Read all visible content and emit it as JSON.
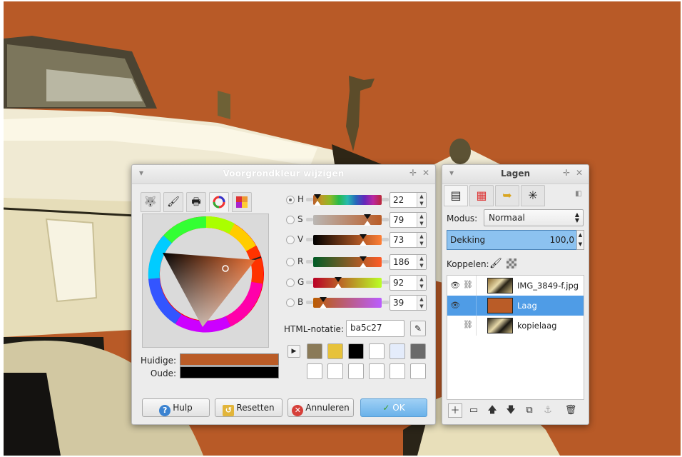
{
  "color_dialog": {
    "title": "Voorgrondkleur wijzigen",
    "tabs": [
      "gimp-wilber",
      "brush",
      "printer-cmyk",
      "color-wheel",
      "color-palette"
    ],
    "current_label": "Huidige:",
    "old_label": "Oude:",
    "current_color": "#ba5c27",
    "old_color": "#000000",
    "sliders": [
      {
        "letter": "H",
        "value": "22",
        "fraction": 0.06
      },
      {
        "letter": "S",
        "value": "79",
        "fraction": 0.79
      },
      {
        "letter": "V",
        "value": "73",
        "fraction": 0.73
      },
      {
        "letter": "R",
        "value": "186",
        "fraction": 0.73
      },
      {
        "letter": "G",
        "value": "92",
        "fraction": 0.36
      },
      {
        "letter": "B",
        "value": "39",
        "fraction": 0.15
      }
    ],
    "html_label": "HTML-notatie:",
    "html_value": "ba5c27",
    "history_colors": [
      "#8a7a58",
      "#e7c23a",
      "#000000",
      "#ffffff",
      "#e4ecfb",
      "#6a6a6a",
      "#ffffff",
      "#ffffff",
      "#ffffff",
      "#ffffff",
      "#ffffff",
      "#ffffff"
    ],
    "buttons": {
      "help": "Hulp",
      "reset": "Resetten",
      "cancel": "Annuleren",
      "ok": "OK"
    }
  },
  "layers_dialog": {
    "title": "Lagen",
    "tabs": [
      "layers-icon",
      "channels-icon",
      "paths-icon",
      "undo-icon"
    ],
    "mode_label": "Modus:",
    "mode_value": "Normaal",
    "opacity_label": "Dekking",
    "opacity_value": "100,0",
    "link_label": "Koppelen:",
    "layers": [
      {
        "name": "IMG_3849-f.jpg",
        "visible": true,
        "selected": false
      },
      {
        "name": "Laag",
        "visible": true,
        "selected": true
      },
      {
        "name": "kopielaag",
        "visible": false,
        "selected": false
      }
    ]
  }
}
